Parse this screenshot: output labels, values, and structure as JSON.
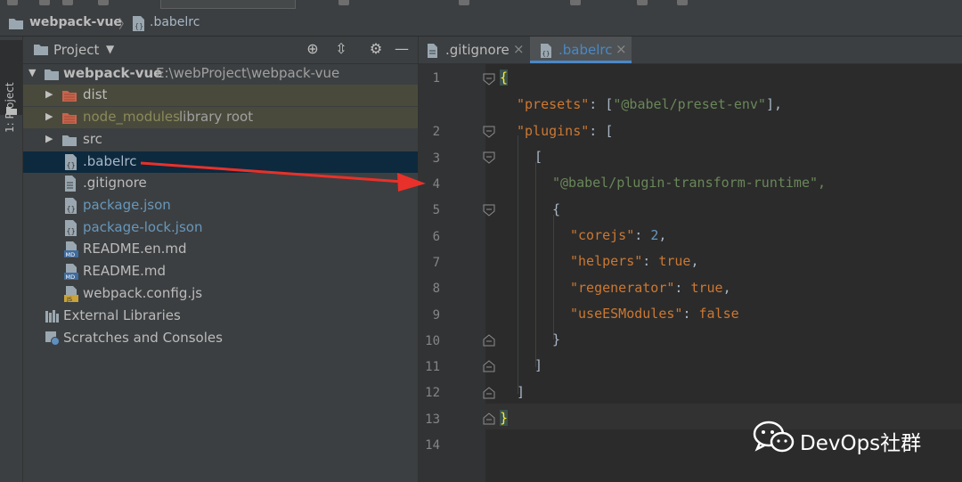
{
  "navbar": {
    "project": "webpack-vue",
    "file": ".babelrc"
  },
  "strip": {
    "project_tab": "1: Project"
  },
  "project_panel": {
    "title": "Project",
    "root": {
      "name": "webpack-vue",
      "path": "E:\\webProject\\webpack-vue"
    },
    "items": [
      {
        "label": "dist",
        "kind": "folder-excluded"
      },
      {
        "label": "node_modules",
        "suffix": "library root",
        "kind": "folder-excluded"
      },
      {
        "label": "src",
        "kind": "folder"
      },
      {
        "label": ".babelrc",
        "kind": "config-file",
        "selected": true
      },
      {
        "label": ".gitignore",
        "kind": "text-file"
      },
      {
        "label": "package.json",
        "kind": "json-file"
      },
      {
        "label": "package-lock.json",
        "kind": "json-file"
      },
      {
        "label": "README.en.md",
        "kind": "md-file"
      },
      {
        "label": "README.md",
        "kind": "md-file"
      },
      {
        "label": "webpack.config.js",
        "kind": "js-file"
      }
    ],
    "external_libraries": "External Libraries",
    "scratches": "Scratches and Consoles"
  },
  "tabs": [
    {
      "label": ".gitignore",
      "active": false
    },
    {
      "label": ".babelrc",
      "active": true
    }
  ],
  "code": {
    "line_numbers": [
      "1",
      "2",
      "3",
      "4",
      "5",
      "6",
      "7",
      "8",
      "9",
      "10",
      "11",
      "12",
      "13",
      "14"
    ],
    "lines": [
      "{",
      "\"presets\": [\"@babel/preset-env\"],",
      "\"plugins\": [",
      "[",
      "\"@babel/plugin-transform-runtime\",",
      "{",
      "\"corejs\": 2,",
      "\"helpers\": true,",
      "\"regenerator\": true,",
      "\"useESModules\": false",
      "}",
      "]",
      "]",
      "}"
    ]
  },
  "watermark": "DevOps社群",
  "colors": {
    "string": "#6a8759",
    "keyword": "#cc7832",
    "number": "#6897bb",
    "annotation_arrow": "#e8312a"
  }
}
